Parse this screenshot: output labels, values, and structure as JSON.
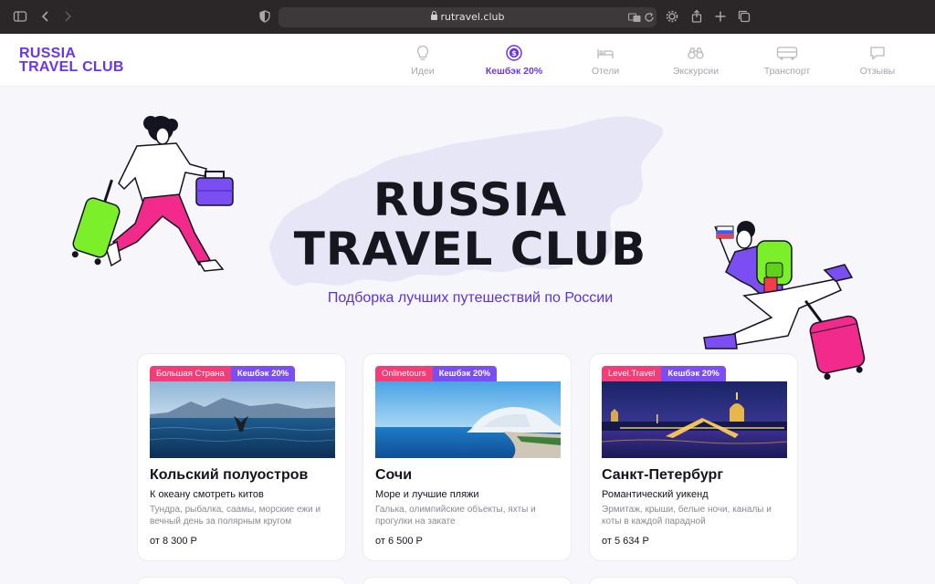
{
  "browser": {
    "url": "rutravel.club"
  },
  "site": {
    "logo_line1": "RUSSIA",
    "logo_line2": "TRAVEL CLUB",
    "brand_color": "#6a34f0",
    "accent_pink": "#f23d79",
    "nav": [
      {
        "label": "Идеи",
        "icon": "lightbulb-icon",
        "active": false
      },
      {
        "label": "Кешбэк 20%",
        "icon": "coin-icon",
        "active": true
      },
      {
        "label": "Отели",
        "icon": "bed-icon",
        "active": false
      },
      {
        "label": "Экскурсии",
        "icon": "binoculars-icon",
        "active": false
      },
      {
        "label": "Транспорт",
        "icon": "bus-icon",
        "active": false
      },
      {
        "label": "Отзывы",
        "icon": "chat-bubble-icon",
        "active": false
      }
    ]
  },
  "hero": {
    "title_line1": "RUSSIA",
    "title_line2": "TRAVEL CLUB",
    "subtitle": "Подборка лучших путешествий по России"
  },
  "cards": [
    {
      "partner": "Большая Страна",
      "cashback": "Кешбэк 20%",
      "title": "Кольский полуостров",
      "subtitle": "К океану смотреть китов",
      "description": "Тундра, рыбалка, саамы, морские ежи и вечный день за полярным кругом",
      "price": "от 8 300 Р",
      "photo": "whale-tail-sea"
    },
    {
      "partner": "Onlinetours",
      "cashback": "Кешбэк 20%",
      "title": "Сочи",
      "subtitle": "Море и лучшие пляжи",
      "description": "Галька, олимпийские объекты, яхты и прогулки на закате",
      "price": "от 6 500 Р",
      "photo": "sochi-stadium-beach"
    },
    {
      "partner": "Level.Travel",
      "cashback": "Кешбэк 20%",
      "title": "Санкт-Петербург",
      "subtitle": "Романтический уикенд",
      "description": "Эрмитаж, крыши, белые ночи, каналы и коты в каждой парадной",
      "price": "от 5 634 Р",
      "photo": "spb-night-bridge"
    }
  ]
}
